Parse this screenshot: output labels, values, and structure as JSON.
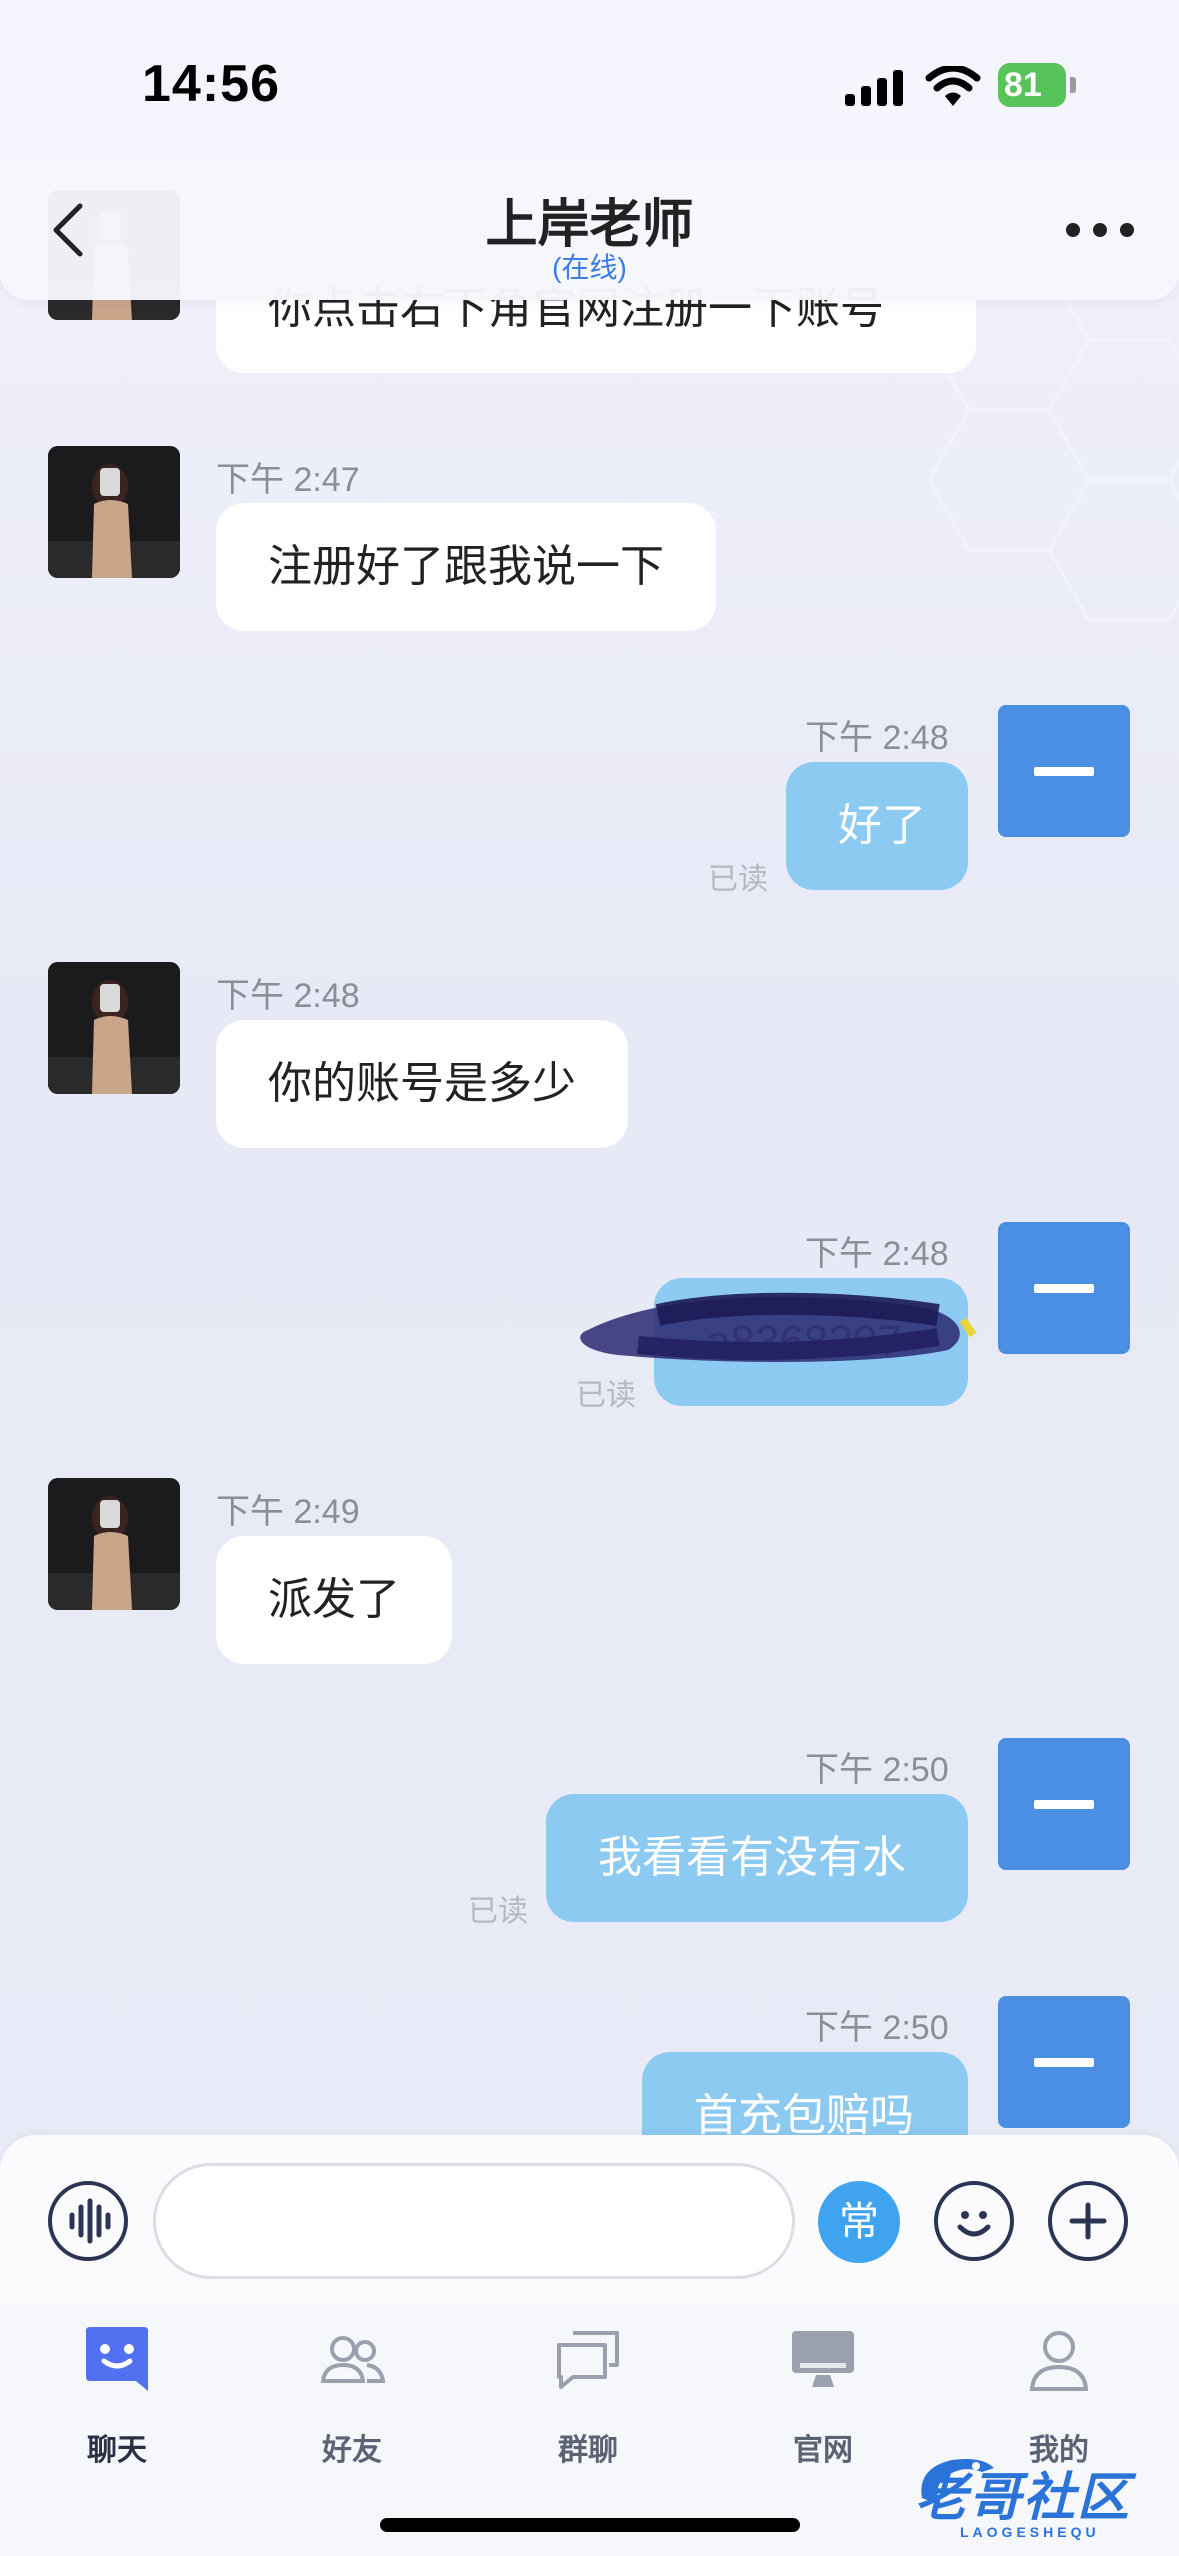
{
  "status_bar": {
    "time": "14:56",
    "battery": "81"
  },
  "header": {
    "title": "上岸老师",
    "subtitle": "(在线)"
  },
  "messages": [
    {
      "side": "in",
      "text": "你点击右下角官网注册一下账号"
    },
    {
      "side": "in",
      "time": "下午 2:47",
      "text": "注册好了跟我说一下"
    },
    {
      "side": "out",
      "time": "下午 2:48",
      "text": "好了",
      "status": "已读"
    },
    {
      "side": "in",
      "time": "下午 2:48",
      "text": "你的账号是多少"
    },
    {
      "side": "out",
      "time": "下午 2:48",
      "text": "a8368307",
      "status": "已读"
    },
    {
      "side": "in",
      "time": "下午 2:49",
      "text": "派发了"
    },
    {
      "side": "out",
      "time": "下午 2:50",
      "text": "我看看有没有水",
      "status": "已读"
    },
    {
      "side": "out",
      "time": "下午 2:50",
      "text": "首充包赔吗"
    }
  ],
  "input_bar": {
    "common_label": "常",
    "placeholder": ""
  },
  "tabs": [
    {
      "label": "聊天",
      "icon": "chat-icon",
      "active": true
    },
    {
      "label": "好友",
      "icon": "friends-icon"
    },
    {
      "label": "群聊",
      "icon": "group-chat-icon"
    },
    {
      "label": "官网",
      "icon": "website-icon"
    },
    {
      "label": "我的",
      "icon": "profile-icon"
    }
  ],
  "watermark": {
    "text": "老哥社区",
    "sub": "LAOGESHEQU"
  },
  "colors": {
    "accent": "#3fa3f0",
    "out_bubble": "#8ccaf2",
    "self_avatar": "#4a8fe4",
    "header_subtitle": "#3a7de6"
  }
}
